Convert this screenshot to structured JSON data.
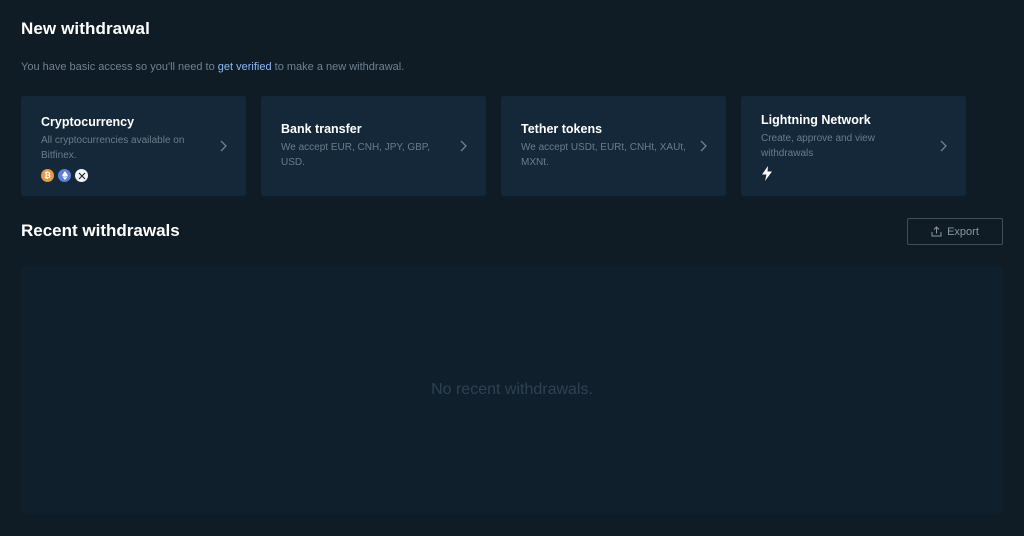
{
  "header": {
    "title": "New withdrawal",
    "subtitle_before": "You have basic access so you'll need to ",
    "subtitle_link": "get verified",
    "subtitle_after": " to make a new withdrawal."
  },
  "cards": [
    {
      "title": "Cryptocurrency",
      "description": "All cryptocurrencies available on Bitfinex.",
      "icons": [
        "bitcoin-icon",
        "ethereum-icon",
        "xrp-icon"
      ]
    },
    {
      "title": "Bank transfer",
      "description": "We accept EUR, CNH, JPY, GBP, USD."
    },
    {
      "title": "Tether tokens",
      "description": "We accept USDt, EURt, CNHt, XAUt, MXNt."
    },
    {
      "title": "Lightning Network",
      "description": "Create, approve and view withdrawals",
      "icons": [
        "lightning-icon"
      ]
    }
  ],
  "recent": {
    "title": "Recent withdrawals",
    "export_label": "Export",
    "empty_message": "No recent withdrawals."
  },
  "colors": {
    "background": "#101c25",
    "card": "#15283a",
    "link": "#8fb7f5",
    "bitcoin": "#e59a44",
    "ethereum": "#5d7fd6"
  }
}
